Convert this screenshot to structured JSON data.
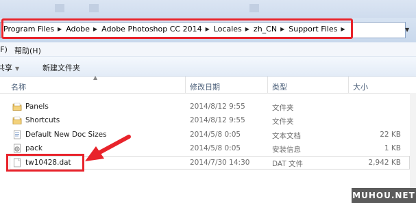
{
  "breadcrumb": {
    "items": [
      "Program Files",
      "Adobe",
      "Adobe Photoshop CC 2014",
      "Locales",
      "zh_CN",
      "Support Files"
    ]
  },
  "menu": {
    "help": "帮助(H)",
    "partial_left": "(F)"
  },
  "toolbar": {
    "share": "共享",
    "new_folder": "新建文件夹"
  },
  "columns": {
    "name": "名称",
    "date": "修改日期",
    "type": "类型",
    "size": "大小"
  },
  "files": [
    {
      "name": "Panels",
      "date": "2014/8/12 9:55",
      "type": "文件夹",
      "size": "",
      "icon": "folder-icon"
    },
    {
      "name": "Shortcuts",
      "date": "2014/8/12 9:55",
      "type": "文件夹",
      "size": "",
      "icon": "folder-icon"
    },
    {
      "name": "Default New Doc Sizes",
      "date": "2014/5/8 0:05",
      "type": "文本文档",
      "size": "22 KB",
      "icon": "text-document-icon"
    },
    {
      "name": "pack",
      "date": "2014/5/8 0:05",
      "type": "安装信息",
      "size": "1 KB",
      "icon": "setup-info-icon"
    },
    {
      "name": "tw10428.dat",
      "date": "2014/7/30 14:30",
      "type": "DAT 文件",
      "size": "2,942 KB",
      "icon": "dat-file-icon"
    }
  ],
  "watermark": "MUHOU.NET",
  "colors": {
    "highlight": "#e8232b",
    "address_bg": "#d7e3f2"
  }
}
